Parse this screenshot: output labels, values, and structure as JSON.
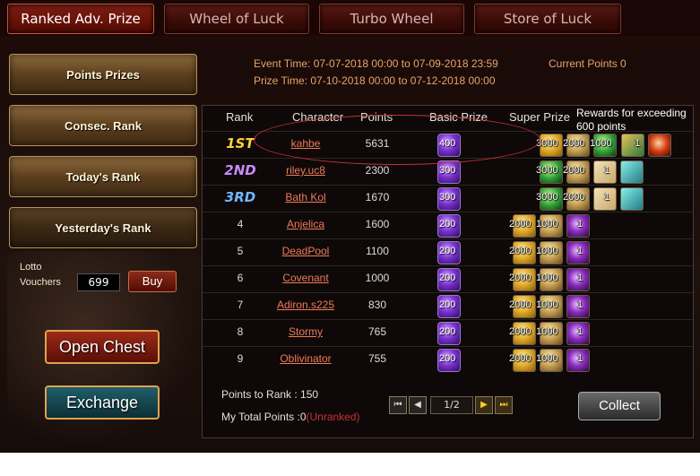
{
  "tabs": [
    "Ranked Adv. Prize",
    "Wheel of Luck",
    "Turbo Wheel",
    "Store of Luck"
  ],
  "sidebar": {
    "items": [
      "Points Prizes",
      "Consec. Rank",
      "Today's Rank",
      "Yesterday's Rank"
    ],
    "lotto_label_1": "Lotto",
    "lotto_label_2": "Vouchers",
    "lotto_value": "699",
    "buy_label": "Buy",
    "open_chest_label": "Open Chest",
    "exchange_label": "Exchange"
  },
  "event": {
    "event_time": "Event Time: 07-07-2018 00:00 to 07-09-2018 23:59",
    "prize_time": "Prize Time: 07-10-2018 00:00 to 07-12-2018 00:00",
    "current_points": "Current Points 0"
  },
  "table": {
    "headers": {
      "rank": "Rank",
      "character": "Character",
      "points": "Points",
      "basic": "Basic Prize",
      "super": "Super Prize"
    },
    "rewards_note": "Rewards for exceeding 600 points",
    "rows": [
      {
        "rank": "1ST",
        "name": "kahbe",
        "points": "5631",
        "basic": "400",
        "super": [
          "3000",
          "2000",
          "1000"
        ],
        "extra": "1"
      },
      {
        "rank": "2ND",
        "name": "riley.uc8",
        "points": "2300",
        "basic": "300",
        "super": [
          "3000",
          "2000",
          "1"
        ],
        "extra": ""
      },
      {
        "rank": "3RD",
        "name": "Bath Kol",
        "points": "1670",
        "basic": "300",
        "super": [
          "3000",
          "2000",
          "1"
        ],
        "extra": ""
      },
      {
        "rank": "4",
        "name": "Anjelica",
        "points": "1600",
        "basic": "200",
        "super": [
          "2000",
          "1000",
          "1"
        ]
      },
      {
        "rank": "5",
        "name": "DeadPool",
        "points": "1100",
        "basic": "200",
        "super": [
          "2000",
          "1000",
          "1"
        ]
      },
      {
        "rank": "6",
        "name": "Covenant",
        "points": "1000",
        "basic": "200",
        "super": [
          "2000",
          "1000",
          "1"
        ]
      },
      {
        "rank": "7",
        "name": "Adiron.s225",
        "points": "830",
        "basic": "200",
        "super": [
          "2000",
          "1000",
          "1"
        ]
      },
      {
        "rank": "8",
        "name": "Stormy",
        "points": "765",
        "basic": "200",
        "super": [
          "2000",
          "1000",
          "1"
        ]
      },
      {
        "rank": "9",
        "name": "Oblivinator",
        "points": "755",
        "basic": "200",
        "super": [
          "2000",
          "1000",
          "1"
        ]
      }
    ]
  },
  "footer": {
    "points_to_rank": "Points to Rank : 150",
    "my_total": "My Total Points :0",
    "unranked": "(Unranked)",
    "page": "1/2",
    "collect_label": "Collect"
  }
}
